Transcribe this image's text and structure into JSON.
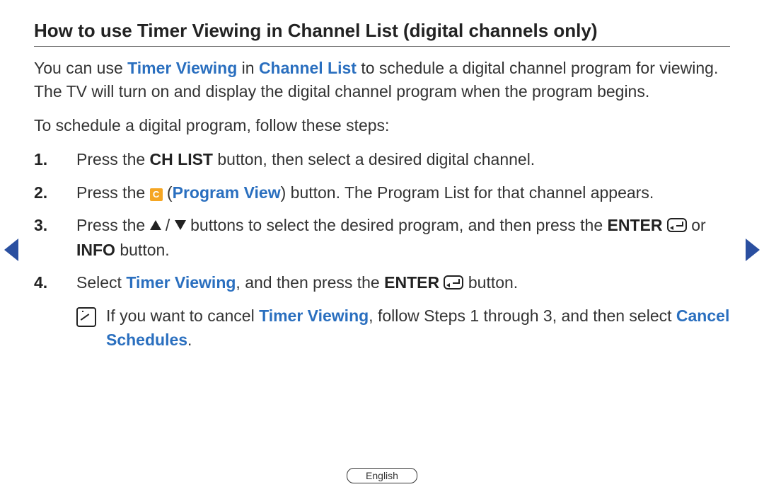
{
  "title": "How to use Timer Viewing in Channel List (digital channels only)",
  "intro": {
    "pre": "You can use ",
    "hl1": "Timer Viewing",
    "mid": " in ",
    "hl2": "Channel List",
    "post": " to schedule a digital channel program for viewing. The TV will turn on and display the digital channel program when the program begins."
  },
  "lead": "To schedule a digital program, follow these steps:",
  "steps": {
    "s1": {
      "num": "1.",
      "a": "Press the ",
      "b": "CH LIST",
      "c": " button, then select a desired digital channel."
    },
    "s2": {
      "num": "2.",
      "a": "Press the ",
      "badge": "C",
      "paren_open": " (",
      "hl": "Program View",
      "paren_close": ")",
      "b": " button. The Program List for that channel appears."
    },
    "s3": {
      "num": "3.",
      "a": "Press the ",
      "slash": " / ",
      "b": " buttons to select the desired program, and then press the ",
      "enter": "ENTER",
      "c": " or ",
      "info": "INFO",
      "d": " button."
    },
    "s4": {
      "num": "4.",
      "a": "Select ",
      "hl": "Timer Viewing",
      "b": ", and then press the ",
      "enter": "ENTER",
      "c": " button."
    }
  },
  "note": {
    "a": "If you want to cancel ",
    "hl1": "Timer Viewing",
    "b": ", follow Steps 1 through 3, and then select ",
    "hl2": "Cancel Schedules",
    "c": "."
  },
  "language": "English"
}
